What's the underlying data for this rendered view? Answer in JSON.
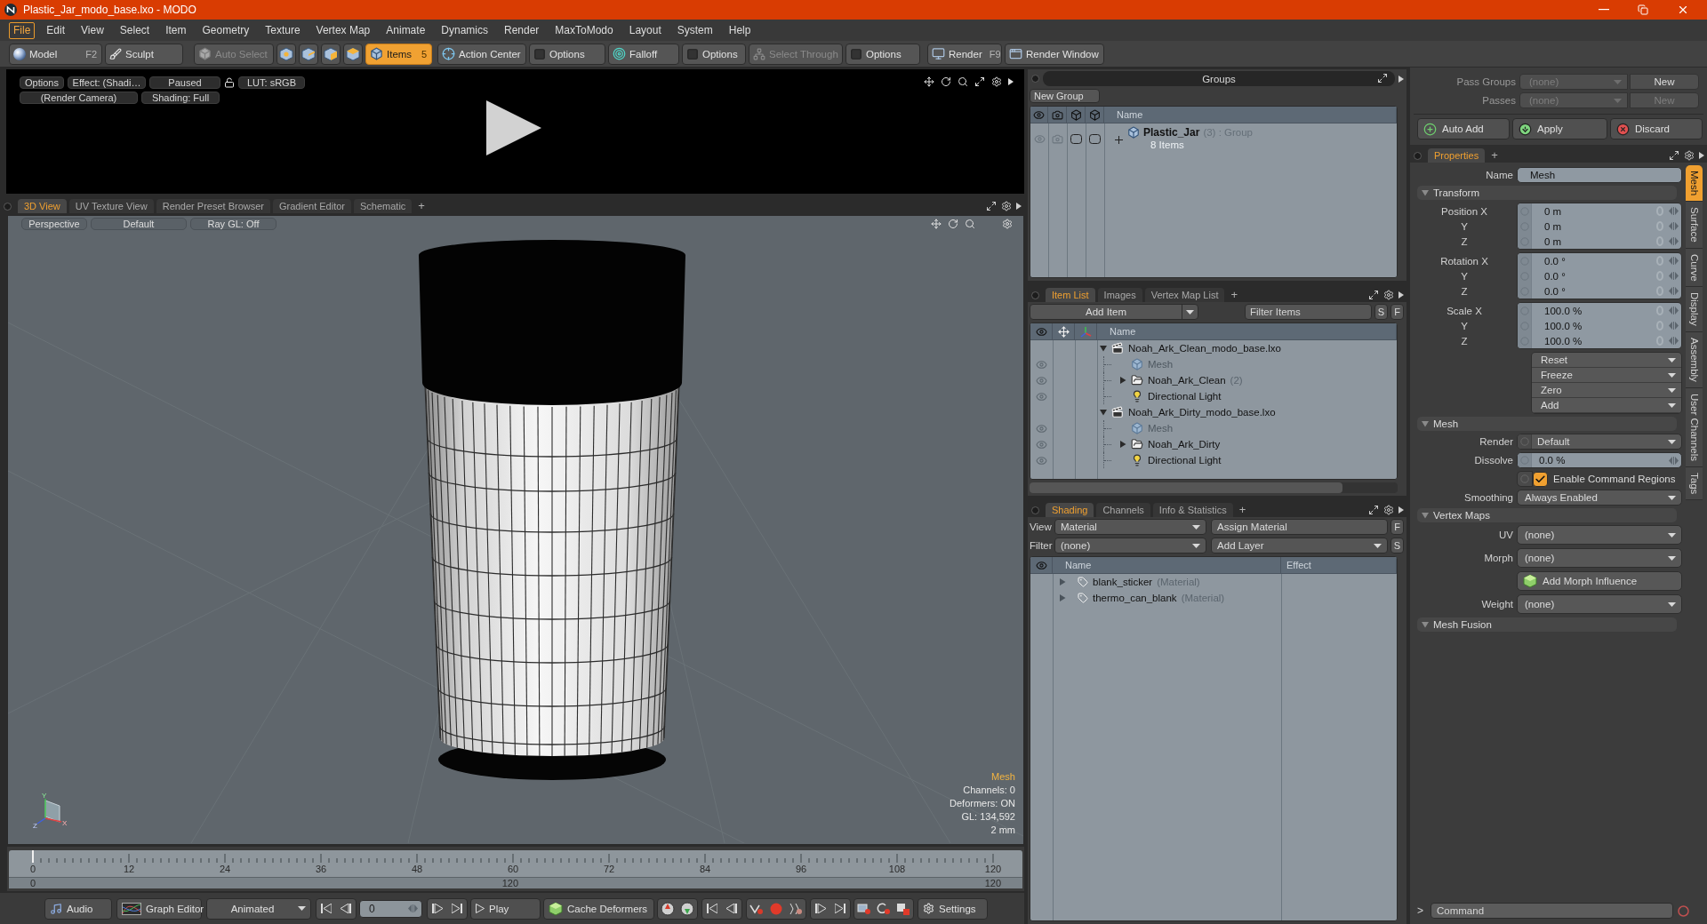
{
  "window": {
    "title": "Plastic_Jar_modo_base.lxo - MODO"
  },
  "menu": [
    {
      "label": "File",
      "selected": true
    },
    {
      "label": "Edit",
      "selected": false
    },
    {
      "label": "View",
      "selected": false
    },
    {
      "label": "Select",
      "selected": false
    },
    {
      "label": "Item",
      "selected": false
    },
    {
      "label": "Geometry",
      "selected": false
    },
    {
      "label": "Texture",
      "selected": false
    },
    {
      "label": "Vertex Map",
      "selected": false
    },
    {
      "label": "Animate",
      "selected": false
    },
    {
      "label": "Dynamics",
      "selected": false
    },
    {
      "label": "Render",
      "selected": false
    },
    {
      "label": "MaxToModo",
      "selected": false
    },
    {
      "label": "Layout",
      "selected": false
    },
    {
      "label": "System",
      "selected": false
    },
    {
      "label": "Help",
      "selected": false
    }
  ],
  "toolbar": {
    "groups": [
      [
        {
          "label": "Model",
          "shortcut": "F2",
          "selected": false,
          "disabled": false
        },
        {
          "label": "Sculpt",
          "selected": false,
          "disabled": false
        }
      ],
      [
        {
          "label": "Auto Select",
          "selected": false,
          "disabled": true
        }
      ],
      [
        {
          "label": "Items",
          "shortcut": "5",
          "selected": true,
          "disabled": false
        }
      ],
      [
        {
          "label": "Action Center",
          "selected": false,
          "disabled": false
        },
        {
          "label": "Options",
          "selected": false,
          "disabled": false
        },
        {
          "label": "Falloff",
          "selected": false,
          "disabled": false
        },
        {
          "label": "Options",
          "selected": false,
          "disabled": false
        },
        {
          "label": "Select Through",
          "selected": false,
          "disabled": true
        },
        {
          "label": "Options",
          "selected": false,
          "disabled": false
        }
      ],
      [
        {
          "label": "Render",
          "shortcut": "F9",
          "selected": false,
          "disabled": false
        },
        {
          "label": "Render Window",
          "selected": false,
          "disabled": false
        }
      ]
    ]
  },
  "render_preview": {
    "row_1": [
      "Options",
      "Effect: (Shadi…",
      "Paused",
      "LUT: sRGB"
    ],
    "row_2": [
      "(Render Camera)",
      "Shading: Full"
    ]
  },
  "viewport": {
    "tabs": [
      {
        "label": "3D View",
        "selected": true
      },
      {
        "label": "UV Texture View",
        "selected": false
      },
      {
        "label": "Render Preset Browser",
        "selected": false
      },
      {
        "label": "Gradient Editor",
        "selected": false
      },
      {
        "label": "Schematic",
        "selected": false
      }
    ],
    "add_tab": "+",
    "header": [
      "Perspective",
      "Default",
      "Ray GL: Off"
    ],
    "axis_labels": [
      "Y",
      "X",
      "Z"
    ],
    "info_title": "Mesh",
    "info_lines": [
      "Channels: 0",
      "Deformers: ON",
      "GL: 134,592",
      "2 mm"
    ]
  },
  "timeline": {
    "ticks": [
      "0",
      "12",
      "24",
      "36",
      "48",
      "60",
      "72",
      "84",
      "96",
      "108",
      "120"
    ],
    "range_labels": [
      "0",
      "120",
      "120"
    ]
  },
  "bottom_bar": {
    "audio": "Audio",
    "graph_editor": "Graph Editor",
    "mode": "Animated",
    "frame": "0",
    "play": "Play",
    "cache": "Cache Deformers",
    "settings": "Settings"
  },
  "groups": {
    "title": "Groups",
    "new_button": "New Group",
    "name_column": "Name",
    "rows": [
      {
        "name": "Plastic_Jar",
        "detail": "(3) : Group",
        "subtitle": "8 Items",
        "expanded": false
      }
    ]
  },
  "item_list": {
    "tabs": [
      {
        "label": "Item List",
        "selected": true
      },
      {
        "label": "Images",
        "selected": false
      },
      {
        "label": "Vertex Map List",
        "selected": false
      }
    ],
    "add_tab": "+",
    "add_button": "Add Item",
    "filter_placeholder": "Filter Items",
    "buttons": [
      "S",
      "F"
    ],
    "name_column": "Name",
    "tree": [
      {
        "kind": "scene",
        "label": "Noah_Ark_Clean_modo_base.lxo",
        "expanded": true,
        "children": [
          {
            "kind": "mesh",
            "label": "Mesh",
            "visible": true,
            "disabled": true
          },
          {
            "kind": "group",
            "label": "Noah_Ark_Clean",
            "count": "(2)",
            "visible": true,
            "disabled": false,
            "expanded": false
          },
          {
            "kind": "light",
            "label": "Directional Light",
            "visible": true,
            "disabled": false
          }
        ]
      },
      {
        "kind": "scene",
        "label": "Noah_Ark_Dirty_modo_base.lxo",
        "expanded": true,
        "children": [
          {
            "kind": "mesh",
            "label": "Mesh",
            "visible": true,
            "disabled": true
          },
          {
            "kind": "group",
            "label": "Noah_Ark_Dirty",
            "visible": true,
            "disabled": false,
            "expanded": false
          },
          {
            "kind": "light",
            "label": "Directional Light",
            "visible": true,
            "disabled": false
          }
        ]
      }
    ]
  },
  "shading": {
    "tabs": [
      {
        "label": "Shading",
        "selected": true
      },
      {
        "label": "Channels",
        "selected": false
      },
      {
        "label": "Info & Statistics",
        "selected": false
      }
    ],
    "add_tab": "+",
    "view_label": "View",
    "view_value": "Material",
    "assign_button": "Assign Material",
    "view_button": "F",
    "filter_label": "Filter",
    "filter_value": "(none)",
    "add_layer": "Add Layer",
    "filter_button": "S",
    "columns": [
      "Name",
      "Effect"
    ],
    "rows": [
      {
        "name": "blank_sticker",
        "type": "(Material)",
        "expanded": false
      },
      {
        "name": "thermo_can_blank",
        "type": "(Material)",
        "expanded": false
      }
    ]
  },
  "passes": {
    "rows": [
      {
        "label": "Pass Groups",
        "value": "(none)",
        "button": "New",
        "button_disabled": false
      },
      {
        "label": "Passes",
        "value": "(none)",
        "button": "New",
        "button_disabled": true
      }
    ],
    "actions": [
      "Auto Add",
      "Apply",
      "Discard"
    ]
  },
  "properties": {
    "tabs": [
      {
        "label": "Properties",
        "selected": true
      }
    ],
    "add_tab": "+",
    "name_label": "Name",
    "name_value": "Mesh",
    "sections": [
      {
        "title": "Transform",
        "expanded": true,
        "rows": [
          {
            "kind": "vector",
            "fields": [
              {
                "label": "Position X",
                "value": "0 m"
              },
              {
                "label": "Y",
                "value": "0 m"
              },
              {
                "label": "Z",
                "value": "0 m"
              }
            ]
          },
          {
            "kind": "vector",
            "fields": [
              {
                "label": "Rotation X",
                "value": "0.0 °"
              },
              {
                "label": "Y",
                "value": "0.0 °"
              },
              {
                "label": "Z",
                "value": "0.0 °"
              }
            ]
          },
          {
            "kind": "vector",
            "fields": [
              {
                "label": "Scale X",
                "value": "100.0 %"
              },
              {
                "label": "Y",
                "value": "100.0 %"
              },
              {
                "label": "Z",
                "value": "100.0 %"
              }
            ]
          },
          {
            "kind": "menus",
            "items": [
              "Reset",
              "Freeze",
              "Zero",
              "Add"
            ]
          }
        ]
      },
      {
        "title": "Mesh",
        "expanded": true,
        "rows": [
          {
            "kind": "channel_menu",
            "label": "Render",
            "value": "Default"
          },
          {
            "kind": "channel_number",
            "label": "Dissolve",
            "value": "0.0 %"
          },
          {
            "kind": "checkbox",
            "label": "Enable Command Regions",
            "checked": true
          },
          {
            "kind": "menu",
            "label": "Smoothing",
            "value": "Always Enabled"
          }
        ]
      },
      {
        "title": "Vertex Maps",
        "expanded": true,
        "rows": [
          {
            "kind": "menu",
            "label": "UV",
            "value": "(none)"
          },
          {
            "kind": "menu",
            "label": "Morph",
            "value": "(none)"
          },
          {
            "kind": "button",
            "label": "Add Morph Influence"
          },
          {
            "kind": "menu",
            "label": "Weight",
            "value": "(none)"
          }
        ]
      },
      {
        "title": "Mesh Fusion",
        "expanded": true
      }
    ],
    "side_tabs": [
      {
        "label": "Mesh",
        "selected": true
      },
      {
        "label": "Surface",
        "selected": false
      },
      {
        "label": "Curve",
        "selected": false
      },
      {
        "label": "Display",
        "selected": false
      },
      {
        "label": "Assembly",
        "selected": false
      },
      {
        "label": "User Channels",
        "selected": false
      },
      {
        "label": "Tags",
        "selected": false
      }
    ]
  },
  "command": {
    "prompt": ">",
    "placeholder": "Command"
  }
}
